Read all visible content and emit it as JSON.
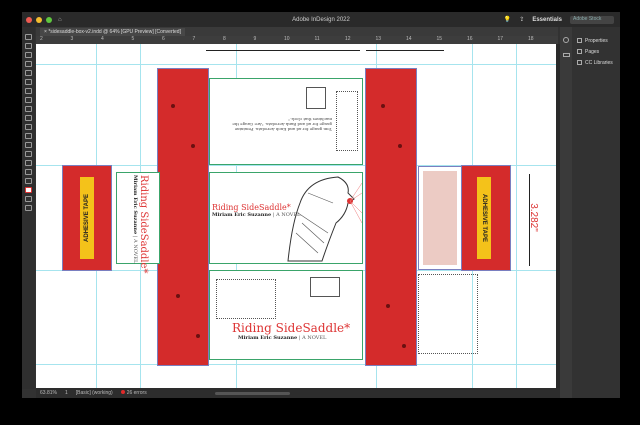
{
  "app": {
    "title": "Adobe InDesign 2022",
    "workspace": "Essentials",
    "search_placeholder": "Adobe Stock"
  },
  "document_tab": "*sidesaddle-box-v2.indd @ 64% [GPU Preview] [Converted]",
  "ruler_ticks": [
    "2",
    "3",
    "4",
    "5",
    "6",
    "7",
    "8",
    "9",
    "10",
    "11",
    "12",
    "13",
    "14",
    "15",
    "16",
    "17",
    "18"
  ],
  "panels": [
    {
      "label": "Properties",
      "icon": "properties-icon"
    },
    {
      "label": "Pages",
      "icon": "pages-icon"
    },
    {
      "label": "CC Libraries",
      "icon": "cc-libraries-icon"
    }
  ],
  "status": {
    "zoom": "63.81%",
    "page": "1",
    "style": "[Basic] (working)",
    "errors": "26 errors"
  },
  "artwork": {
    "book_title": "Riding SideSaddle*",
    "author": "Miriam Eric Suzanne",
    "subtitle": "| A NOVEL",
    "tape_label": "ADHESIVE TAPE",
    "dimension": "3.282\"",
    "flap_text": "Tom gauge for ad and Knob Aerodata. Feminine gauge for ad and Bank Aerodata. \"Are Gauge the machines that clock.\""
  },
  "colors": {
    "red": "#d42b2b",
    "tape": "#f4c21a",
    "guide": "#a6e4ee",
    "frame": "#3aa46a"
  }
}
